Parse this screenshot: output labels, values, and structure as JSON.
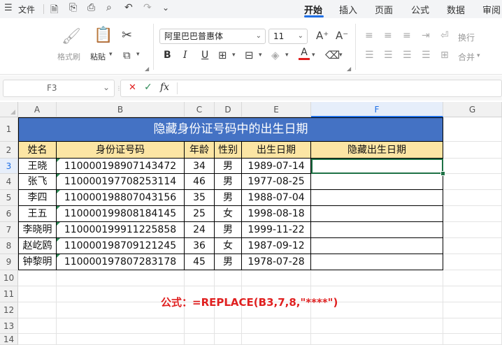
{
  "menu": {
    "file_label": "文件",
    "tabs": [
      "开始",
      "插入",
      "页面",
      "公式",
      "数据",
      "审阅"
    ],
    "active_tab": "开始"
  },
  "ribbon": {
    "format_painter": "格式刷",
    "paste": "粘贴",
    "font_name": "阿里巴巴普惠体",
    "font_size": "11",
    "wrap": "换行",
    "merge": "合并",
    "bold": "B",
    "italic": "I",
    "underline": "U",
    "font_color_glyph": "A",
    "grow_font": "A⁺",
    "shrink_font": "A⁻",
    "font_color": "#e02020"
  },
  "formula_bar": {
    "cell_ref": "F3",
    "cancel": "✕",
    "confirm": "✓",
    "fx": "fx",
    "content": ""
  },
  "columns": [
    "A",
    "B",
    "C",
    "D",
    "E",
    "F",
    "G"
  ],
  "selected_column": "F",
  "selected_row": "3",
  "rows": [
    "1",
    "2",
    "3",
    "4",
    "5",
    "6",
    "7",
    "8",
    "9",
    "10",
    "11",
    "12",
    "13",
    "14"
  ],
  "sheet": {
    "title": "隐藏身份证号码中的出生日期",
    "headers": [
      "姓名",
      "身份证号码",
      "年龄",
      "性别",
      "出生日期",
      "隐藏出生日期"
    ],
    "records": [
      [
        "王晓",
        "110000198907143472",
        "34",
        "男",
        "1989-07-14",
        ""
      ],
      [
        "张飞",
        "110000197708253114",
        "46",
        "男",
        "1977-08-25",
        ""
      ],
      [
        "李四",
        "110000198807043156",
        "35",
        "男",
        "1988-07-04",
        ""
      ],
      [
        "王五",
        "110000199808184145",
        "25",
        "女",
        "1998-08-18",
        ""
      ],
      [
        "李晓明",
        "110000199911225858",
        "24",
        "男",
        "1999-11-22",
        ""
      ],
      [
        "赵屹鸥",
        "110000198709121245",
        "36",
        "女",
        "1987-09-12",
        ""
      ],
      [
        "钟黎明",
        "110000197807283178",
        "45",
        "男",
        "1978-07-28",
        ""
      ]
    ],
    "header_fill": "#fce5a4",
    "title_fill": "#4472c4"
  },
  "note": "公式：=REPLACE(B3,7,8,\"****\")",
  "note_color": "#e02020"
}
